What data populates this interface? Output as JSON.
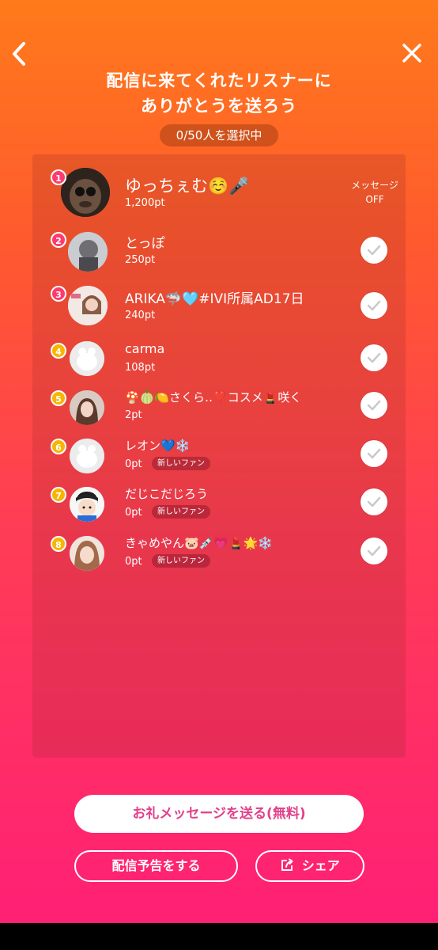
{
  "header": {
    "title_line1": "配信に来てくれたリスナーに",
    "title_line2": "ありがとうを送ろう",
    "selected_count": "0/50人を選択中"
  },
  "top_listener": {
    "rank": "1",
    "name": "ゆっちぇむ☺️🎤",
    "points": "1,200pt",
    "message_label": "メッセージ",
    "message_state": "OFF"
  },
  "listeners": [
    {
      "rank": "2",
      "name": "とっぽ",
      "points": "250pt",
      "badge": ""
    },
    {
      "rank": "3",
      "name": "ARIKA🦈🩵#IVI所属AD17日",
      "points": "240pt",
      "badge": ""
    },
    {
      "rank": "4",
      "name": "carma",
      "points": "108pt",
      "badge": ""
    },
    {
      "rank": "5",
      "name": "🍄🍈🍋さくら‥❣️コスメ💄咲く",
      "points": "2pt",
      "badge": ""
    },
    {
      "rank": "6",
      "name": "レオン💙❄️",
      "points": "0pt",
      "badge": "新しいファン"
    },
    {
      "rank": "7",
      "name": "だじこだじろう",
      "points": "0pt",
      "badge": "新しいファン"
    },
    {
      "rank": "8",
      "name": "きゃめやん🐷💉💗💄🌟❄️",
      "points": "0pt",
      "badge": "新しいファン"
    }
  ],
  "actions": {
    "send_label": "お礼メッセージを送る(無料)",
    "announce_label": "配信予告をする",
    "share_label": "シェア"
  },
  "colors": {
    "accent": "#e2408a",
    "rank_top": "#ff3a6e",
    "rank_other": "#f7b500"
  }
}
